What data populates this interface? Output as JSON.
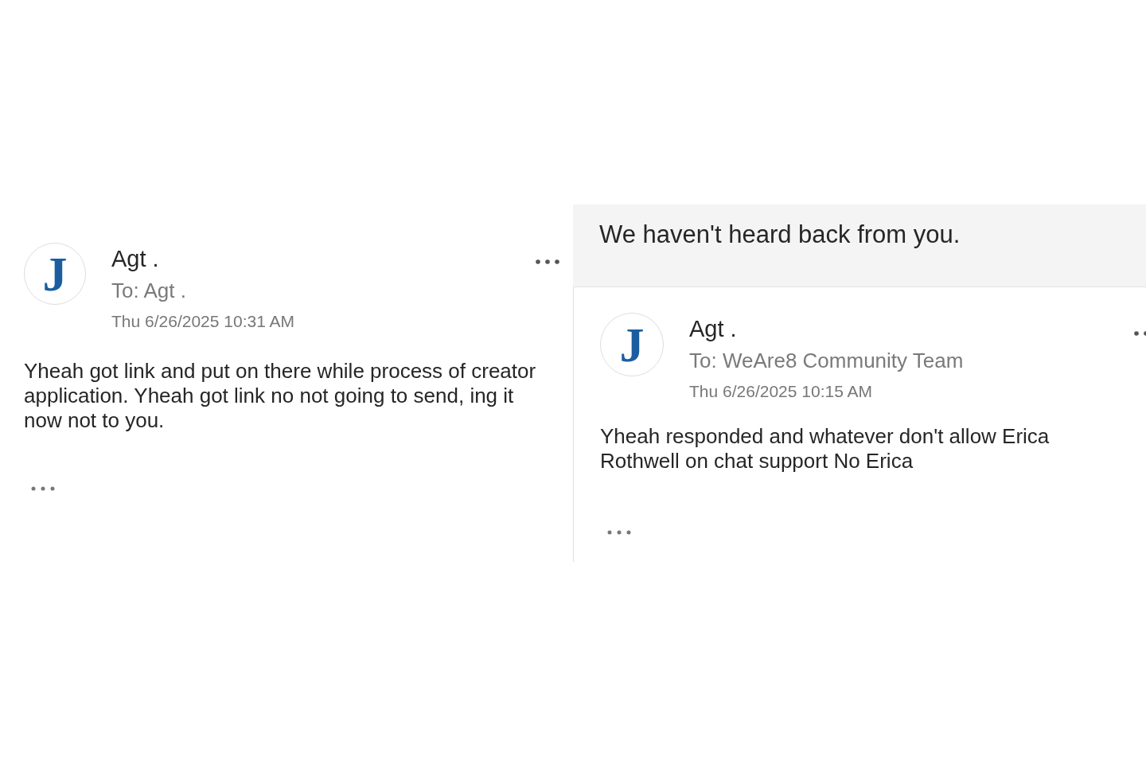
{
  "panels": [
    {
      "message": {
        "avatar_letter": "J",
        "sender": "Agt .",
        "to": "To: Agt .",
        "date": "Thu 6/26/2025 10:31 AM",
        "body": "Yheah got link and put on there while process of creator application. Yheah got link no not going to send, ing it now not to you."
      }
    },
    {
      "banner": "We haven't heard back from you.",
      "message": {
        "avatar_letter": "J",
        "sender": "Agt .",
        "to": "To: WeAre8 Community Team",
        "date": "Thu 6/26/2025 10:15 AM",
        "body": "Yheah responded and whatever don't allow Erica Rothwell on chat support No Erica"
      }
    }
  ]
}
